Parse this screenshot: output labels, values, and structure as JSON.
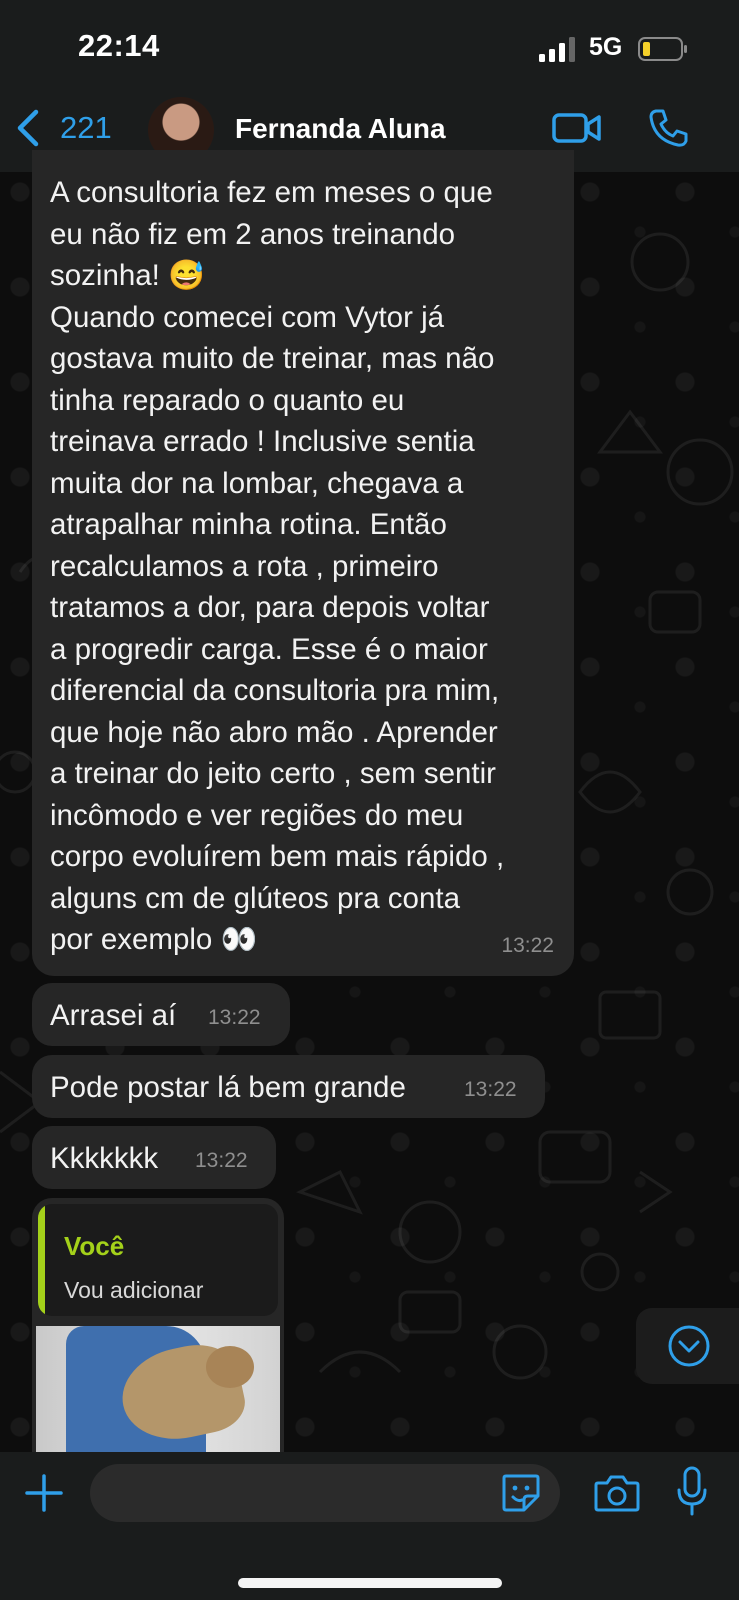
{
  "status_bar": {
    "time": "22:14",
    "network": "5G"
  },
  "header": {
    "back_count": "221",
    "contact_name": "Fernanda Aluna"
  },
  "messages": {
    "long": {
      "lines": [
        "A consultoria fez em meses o que",
        "eu não fiz em 2 anos treinando",
        "sozinha! 😅",
        "Quando comecei com Vytor já",
        "gostava muito de treinar, mas não",
        "tinha reparado o quanto eu",
        "treinava errado ! Inclusive sentia",
        "muita dor na lombar, chegava a",
        "atrapalhar minha rotina. Então",
        "recalculamos a rota , primeiro",
        "tratamos a dor, para depois voltar",
        "a progredir carga. Esse é o maior",
        "diferencial da consultoria pra mim,",
        "que hoje não abro mão . Aprender",
        "a treinar do jeito certo , sem sentir",
        "incômodo e ver regiões do meu",
        "corpo evoluírem bem mais rápido ,",
        "alguns cm de glúteos pra conta",
        "por exemplo 👀"
      ],
      "time": "13:22"
    },
    "arrasei": {
      "text": "Arrasei aí",
      "time": "13:22"
    },
    "pode": {
      "text": "Pode postar lá bem grande",
      "time": "13:22"
    },
    "kkk": {
      "text": "Kkkkkkk",
      "time": "13:22"
    },
    "reply": {
      "quote_author": "Você",
      "quote_text": "Vou adicionar"
    }
  },
  "composer": {
    "placeholder": ""
  },
  "colors": {
    "accent": "#2f9fe9",
    "quote_accent": "#a4d11a",
    "bubble": "#262626"
  }
}
